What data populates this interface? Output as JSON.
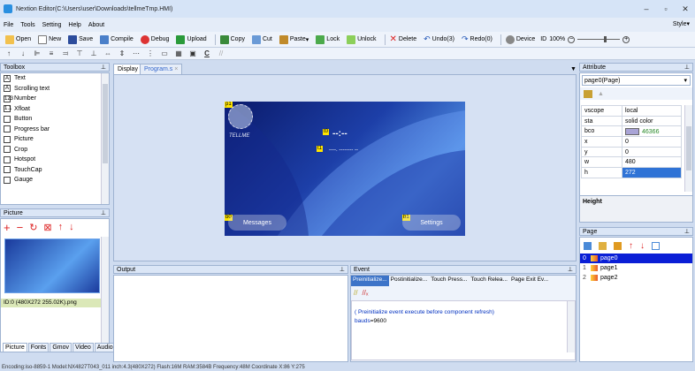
{
  "window": {
    "title": "Nextion Editor(C:\\Users\\user\\Downloads\\tellmeTmp.HMI)"
  },
  "menu": {
    "items": [
      "File",
      "Tools",
      "Setting",
      "Help",
      "About"
    ],
    "style_label": "Style"
  },
  "toolbar": {
    "open": "Open",
    "new": "New",
    "save": "Save",
    "compile": "Compile",
    "debug": "Debug",
    "upload": "Upload",
    "copy": "Copy",
    "cut": "Cut",
    "paste": "Paste",
    "lock": "Lock",
    "unlock": "Unlock",
    "delete": "Delete",
    "undo": "Undo(3)",
    "redo": "Redo(0)",
    "device_id": "Device",
    "id_label": "ID",
    "zoom": "100%"
  },
  "toolbox": {
    "title": "Toolbox",
    "items": [
      "Text",
      "Scrolling text",
      "Number",
      "Xfloat",
      "Button",
      "Progress bar",
      "Picture",
      "Crop",
      "Hotspot",
      "TouchCap",
      "Gauge"
    ],
    "icons": [
      "A",
      "A",
      "123",
      "1.1",
      "",
      "",
      "",
      "",
      "",
      "",
      ""
    ]
  },
  "picture_panel": {
    "title": "Picture",
    "caption": "ID:0  (480X272 255.02K).png",
    "tabs": [
      "Picture",
      "Fonts",
      "Gmov",
      "Video",
      "Audio"
    ]
  },
  "editor": {
    "tabs": [
      "Display",
      "Program.s"
    ],
    "canvas": {
      "p1_label": "p1",
      "brand": "TELLME",
      "t0_label": "t0",
      "t1_label": "t1",
      "time_text": "--:--",
      "date_text": "----. -------- --",
      "b0_label": "b0",
      "b1_label": "b1",
      "messages": "Messages",
      "settings": "Settings"
    }
  },
  "output": {
    "title": "Output"
  },
  "event": {
    "title": "Event",
    "tabs": [
      "Preinitialize...",
      "Postinitialize...",
      "Touch Press...",
      "Touch Relea...",
      "Page Exit Ev..."
    ],
    "comment": "( Preinitialize event execute before component refresh)",
    "code_key": "bauds",
    "code_value": "=9600"
  },
  "attribute": {
    "title": "Attribute",
    "selector": "page0(Page)",
    "rows": [
      [
        "vscope",
        "local"
      ],
      [
        "sta",
        "solid color"
      ],
      [
        "bco",
        "46366"
      ],
      [
        "x",
        "0"
      ],
      [
        "y",
        "0"
      ],
      [
        "w",
        "480"
      ],
      [
        "h",
        "272"
      ]
    ],
    "help_title": "Height",
    "bco_color": "#a9a4d6"
  },
  "page_panel": {
    "title": "Page",
    "pages": [
      {
        "num": "0",
        "name": "page0"
      },
      {
        "num": "1",
        "name": "page1"
      },
      {
        "num": "2",
        "name": "page2"
      }
    ]
  },
  "status": {
    "text": "Encoding:iso-8859-1  Model:NX4827T043_011 inch:4.3(480X272) Flash:16M RAM:3584B Frequency:48M  Coordinate X:86 Y:275"
  }
}
